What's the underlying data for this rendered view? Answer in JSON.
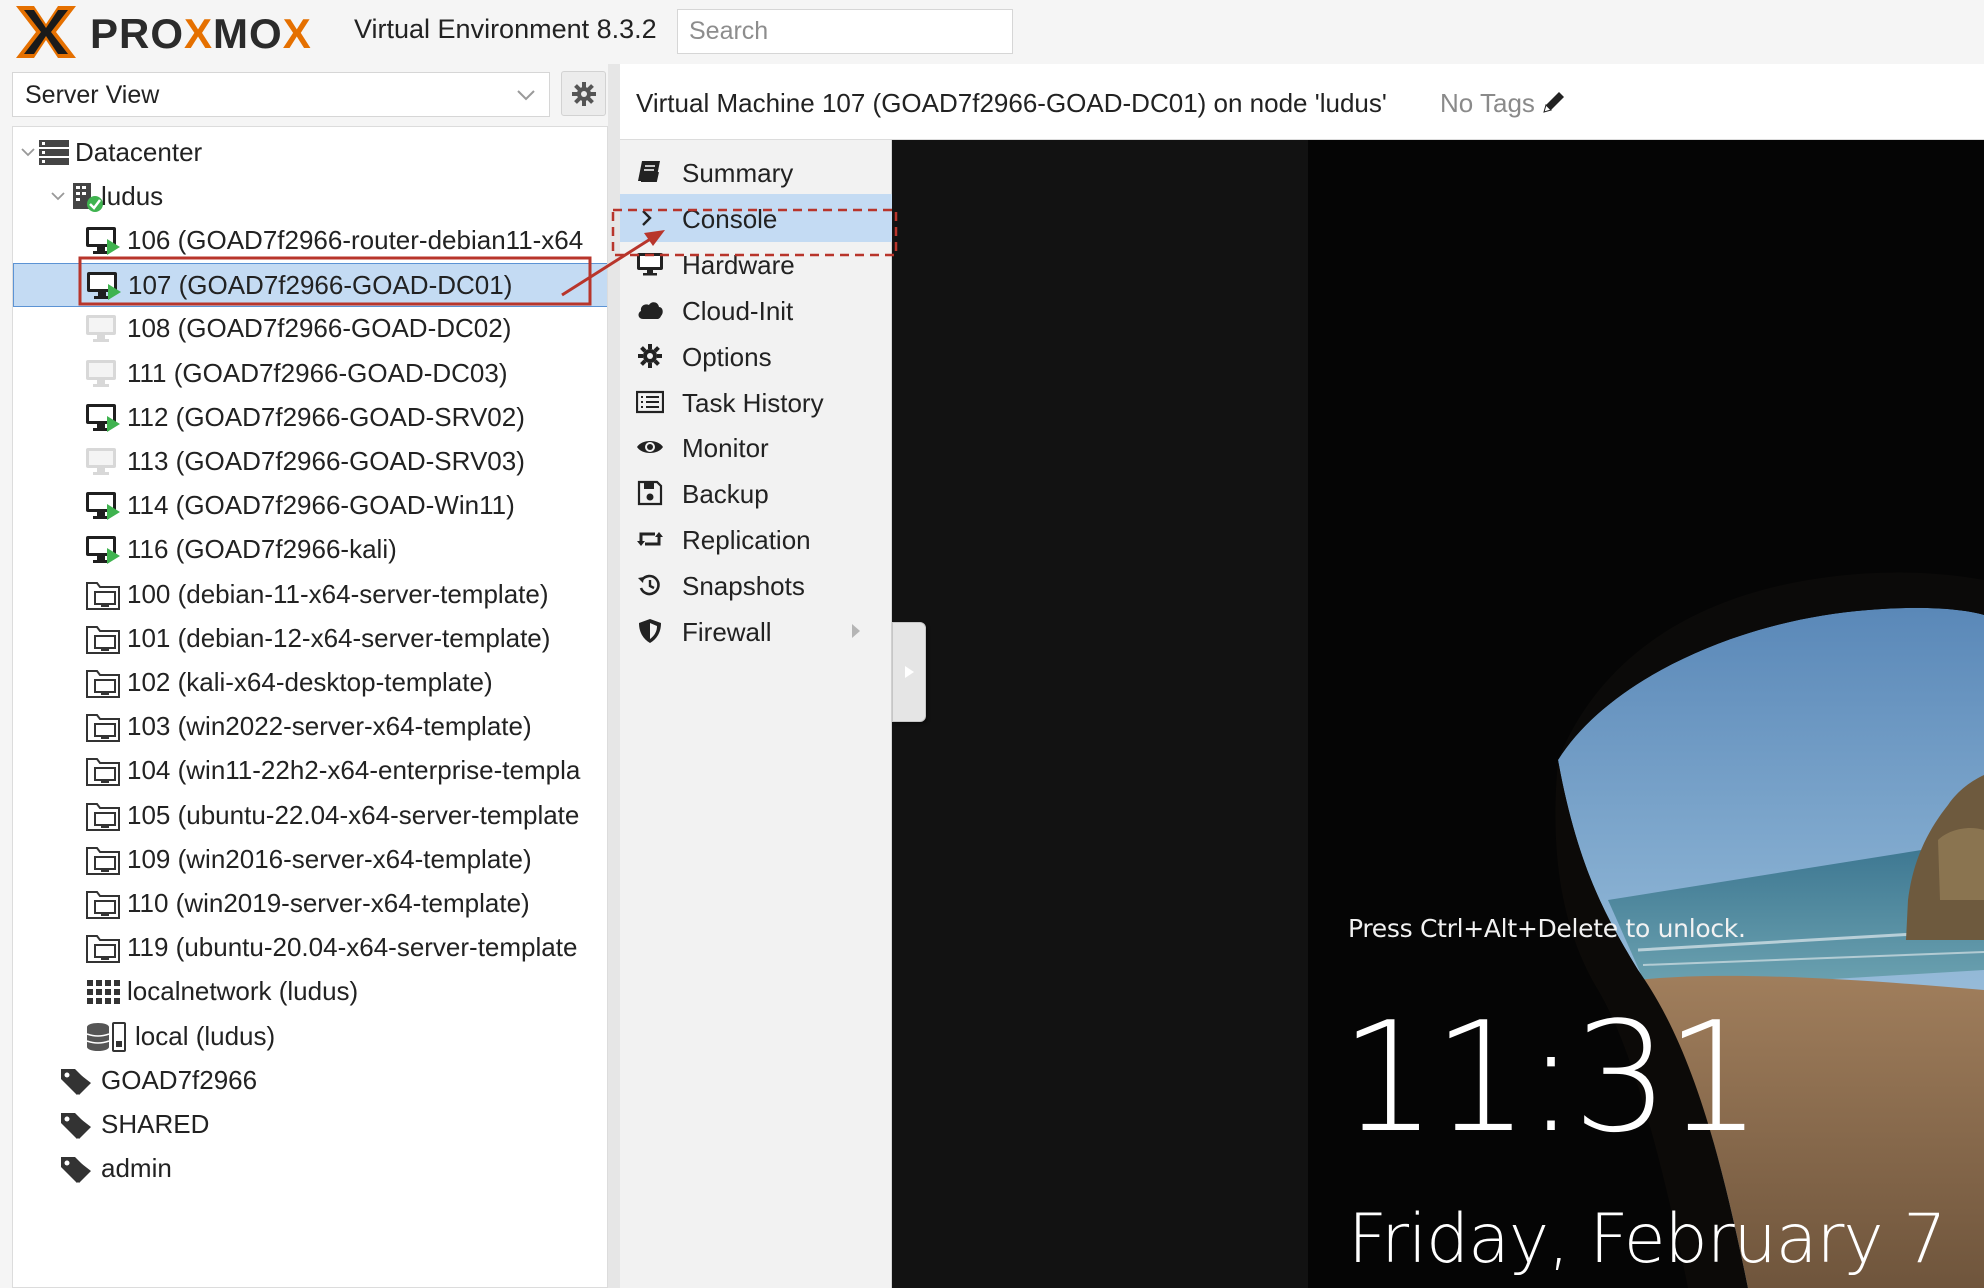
{
  "topbar": {
    "logo_prefix": "PRO",
    "logo_x1": "X",
    "logo_mid": "MO",
    "logo_x2": "X",
    "version": "Virtual Environment 8.3.2",
    "search_placeholder": "Search"
  },
  "left": {
    "view_selector": "Server View",
    "tree": {
      "datacenter": "Datacenter",
      "node": "ludus",
      "items": [
        {
          "label": "106 (GOAD7f2966-router-debian11-x64",
          "type": "vm-running"
        },
        {
          "label": "107 (GOAD7f2966-GOAD-DC01)",
          "type": "vm-running",
          "selected": true
        },
        {
          "label": "108 (GOAD7f2966-GOAD-DC02)",
          "type": "vm-stopped"
        },
        {
          "label": "111 (GOAD7f2966-GOAD-DC03)",
          "type": "vm-stopped"
        },
        {
          "label": "112 (GOAD7f2966-GOAD-SRV02)",
          "type": "vm-running"
        },
        {
          "label": "113 (GOAD7f2966-GOAD-SRV03)",
          "type": "vm-stopped"
        },
        {
          "label": "114 (GOAD7f2966-GOAD-Win11)",
          "type": "vm-running"
        },
        {
          "label": "116 (GOAD7f2966-kali)",
          "type": "vm-running"
        },
        {
          "label": "100 (debian-11-x64-server-template)",
          "type": "template"
        },
        {
          "label": "101 (debian-12-x64-server-template)",
          "type": "template"
        },
        {
          "label": "102 (kali-x64-desktop-template)",
          "type": "template"
        },
        {
          "label": "103 (win2022-server-x64-template)",
          "type": "template"
        },
        {
          "label": "104 (win11-22h2-x64-enterprise-templa",
          "type": "template"
        },
        {
          "label": "105 (ubuntu-22.04-x64-server-template",
          "type": "template"
        },
        {
          "label": "109 (win2016-server-x64-template)",
          "type": "template"
        },
        {
          "label": "110 (win2019-server-x64-template)",
          "type": "template"
        },
        {
          "label": "119 (ubuntu-20.04-x64-server-template",
          "type": "template"
        },
        {
          "label": "localnetwork (ludus)",
          "type": "network"
        },
        {
          "label": "local (ludus)",
          "type": "storage"
        }
      ],
      "tags": [
        "GOAD7f2966",
        "SHARED",
        "admin"
      ]
    }
  },
  "header": {
    "title": "Virtual Machine 107 (GOAD7f2966-GOAD-DC01) on node 'ludus'",
    "tags": "No Tags"
  },
  "menu": {
    "items": [
      {
        "label": "Summary",
        "icon": "book-icon"
      },
      {
        "label": "Console",
        "icon": "chevron-right-icon",
        "active": true
      },
      {
        "label": "Hardware",
        "icon": "desktop-icon"
      },
      {
        "label": "Cloud-Init",
        "icon": "cloud-icon"
      },
      {
        "label": "Options",
        "icon": "gear-icon"
      },
      {
        "label": "Task History",
        "icon": "list-icon"
      },
      {
        "label": "Monitor",
        "icon": "eye-icon"
      },
      {
        "label": "Backup",
        "icon": "floppy-icon"
      },
      {
        "label": "Replication",
        "icon": "retweet-icon"
      },
      {
        "label": "Snapshots",
        "icon": "history-icon"
      },
      {
        "label": "Firewall",
        "icon": "shield-icon"
      }
    ]
  },
  "console": {
    "unlock_message": "Press Ctrl+Alt+Delete to unlock.",
    "time": "11:31",
    "date": "Friday, February 7"
  },
  "colors": {
    "accent_orange": "#e57000",
    "selection": "#c4dbf3",
    "running_green": "#3fb34f",
    "annotation_red": "#c0392b"
  }
}
